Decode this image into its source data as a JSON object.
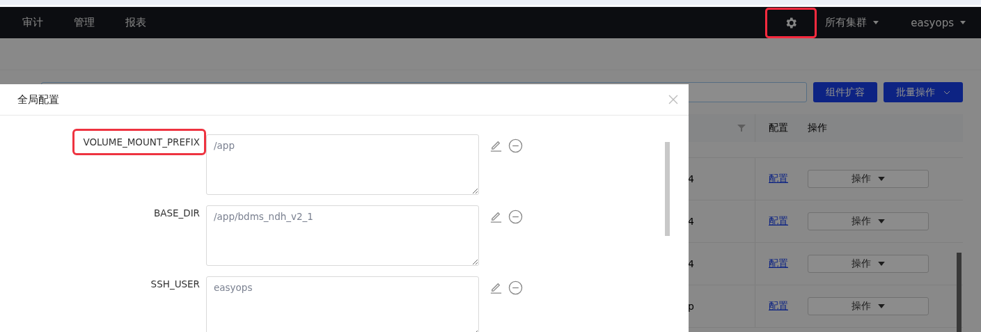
{
  "top_nav": {
    "menu": [
      {
        "label": "审计"
      },
      {
        "label": "管理"
      },
      {
        "label": "报表"
      }
    ],
    "settings_highlighted": true,
    "cluster_select": "所有集群",
    "user_menu": "easyops"
  },
  "toolbar": {
    "buttons": [
      "组件扩容",
      "批量操作"
    ]
  },
  "table": {
    "columns": [
      "配置",
      "操作"
    ],
    "rows": [
      {
        "column_1": "4",
        "config_link": "配置",
        "action": "操作"
      },
      {
        "column_1": "4",
        "config_link": "配置",
        "action": "操作"
      },
      {
        "column_1": "4",
        "config_link": "配置",
        "action": "操作"
      },
      {
        "column_1": "p",
        "config_link": "配置",
        "action": "操作"
      }
    ]
  },
  "dialog": {
    "title": "全局配置",
    "fields": [
      {
        "label": "VOLUME_MOUNT_PREFIX",
        "value": "/app",
        "highlighted": true
      },
      {
        "label": "BASE_DIR",
        "value": "/app/bdms_ndh_v2_1",
        "highlighted": false
      },
      {
        "label": "SSH_USER",
        "value": "easyops",
        "highlighted": false
      }
    ]
  }
}
